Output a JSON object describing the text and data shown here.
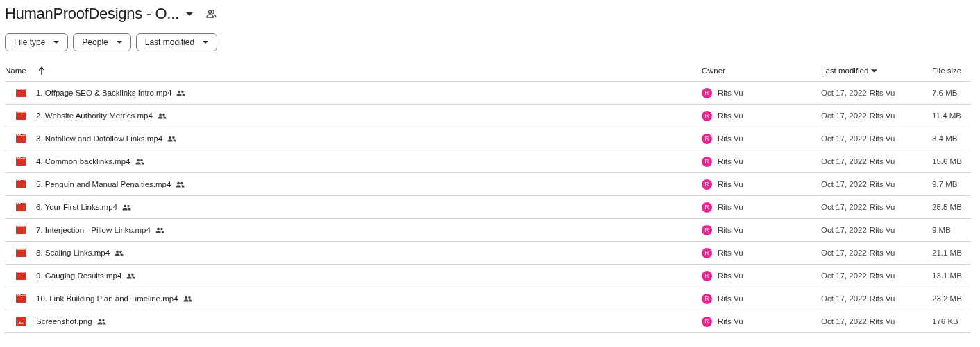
{
  "folder": {
    "title": "HumanProofDesigns - O...",
    "shared": true
  },
  "filters": [
    {
      "label": "File type"
    },
    {
      "label": "People"
    },
    {
      "label": "Last modified"
    }
  ],
  "columns": [
    {
      "label": "Name",
      "sorted": true,
      "dropdown": false
    },
    {
      "label": "Owner",
      "sorted": false,
      "dropdown": false
    },
    {
      "label": "Last modified",
      "sorted": false,
      "dropdown": true
    },
    {
      "label": "File size",
      "sorted": false,
      "dropdown": false
    }
  ],
  "rows": [
    {
      "kind": "video",
      "name": "1. Offpage SEO & Backlinks Intro.mp4",
      "shared": true,
      "owner_initial": "R",
      "owner": "Rits Vu",
      "modified": "Oct 17, 2022",
      "modified_by": "Rits Vu",
      "size": "7.6 MB"
    },
    {
      "kind": "video",
      "name": "2. Website Authority Metrics.mp4",
      "shared": true,
      "owner_initial": "R",
      "owner": "Rits Vu",
      "modified": "Oct 17, 2022",
      "modified_by": "Rits Vu",
      "size": "11.4 MB"
    },
    {
      "kind": "video",
      "name": "3. Nofollow and Dofollow Links.mp4",
      "shared": true,
      "owner_initial": "R",
      "owner": "Rits Vu",
      "modified": "Oct 17, 2022",
      "modified_by": "Rits Vu",
      "size": "8.4 MB"
    },
    {
      "kind": "video",
      "name": "4. Common backlinks.mp4",
      "shared": true,
      "owner_initial": "R",
      "owner": "Rits Vu",
      "modified": "Oct 17, 2022",
      "modified_by": "Rits Vu",
      "size": "15.6 MB"
    },
    {
      "kind": "video",
      "name": "5. Penguin and Manual Penalties.mp4",
      "shared": true,
      "owner_initial": "R",
      "owner": "Rits Vu",
      "modified": "Oct 17, 2022",
      "modified_by": "Rits Vu",
      "size": "9.7 MB"
    },
    {
      "kind": "video",
      "name": "6. Your First Links.mp4",
      "shared": true,
      "owner_initial": "R",
      "owner": "Rits Vu",
      "modified": "Oct 17, 2022",
      "modified_by": "Rits Vu",
      "size": "25.5 MB"
    },
    {
      "kind": "video",
      "name": "7. Interjection - Pillow Links.mp4",
      "shared": true,
      "owner_initial": "R",
      "owner": "Rits Vu",
      "modified": "Oct 17, 2022",
      "modified_by": "Rits Vu",
      "size": "9 MB"
    },
    {
      "kind": "video",
      "name": "8. Scaling Links.mp4",
      "shared": true,
      "owner_initial": "R",
      "owner": "Rits Vu",
      "modified": "Oct 17, 2022",
      "modified_by": "Rits Vu",
      "size": "21.1 MB"
    },
    {
      "kind": "video",
      "name": "9. Gauging Results.mp4",
      "shared": true,
      "owner_initial": "R",
      "owner": "Rits Vu",
      "modified": "Oct 17, 2022",
      "modified_by": "Rits Vu",
      "size": "13.1 MB"
    },
    {
      "kind": "video",
      "name": "10. Link Building Plan and Timeline.mp4",
      "shared": true,
      "owner_initial": "R",
      "owner": "Rits Vu",
      "modified": "Oct 17, 2022",
      "modified_by": "Rits Vu",
      "size": "23.2 MB"
    },
    {
      "kind": "image",
      "name": "Screenshot.png",
      "shared": true,
      "owner_initial": "R",
      "owner": "Rits Vu",
      "modified": "Oct 17, 2022",
      "modified_by": "Rits Vu",
      "size": "176 KB"
    }
  ]
}
